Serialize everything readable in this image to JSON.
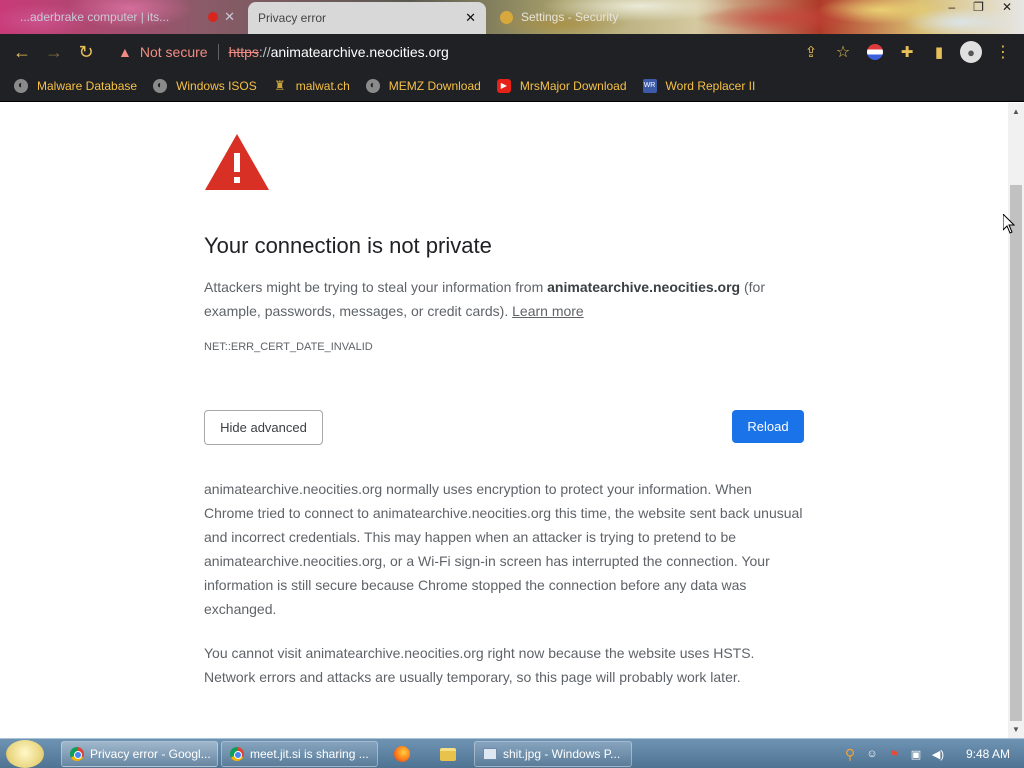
{
  "browser": {
    "tabs": [
      {
        "title": "...aderbrake computer | its...",
        "active": false
      },
      {
        "title": "Privacy error",
        "active": true
      },
      {
        "title": "Settings - Security",
        "active": false
      }
    ],
    "window_controls": {
      "minimize": "–",
      "maximize": "❐",
      "close": "✕"
    },
    "omnibox": {
      "security_label": "Not secure",
      "url_scheme": "https",
      "url_separator": "://",
      "url_host": "animatearchive.neocities.org"
    },
    "bookmarks": [
      {
        "label": "Malware Database",
        "icon": "globe-icon"
      },
      {
        "label": "Windows ISOS",
        "icon": "globe-icon"
      },
      {
        "label": "malwat.ch",
        "icon": "amogus-icon"
      },
      {
        "label": "MEMZ Download",
        "icon": "globe-icon"
      },
      {
        "label": "MrsMajor Download",
        "icon": "youtube-icon"
      },
      {
        "label": "Word Replacer II",
        "icon": "word-replacer-icon"
      }
    ]
  },
  "page": {
    "heading": "Your connection is not private",
    "intro_text": "Attackers might be trying to steal your information from ",
    "intro_domain": "animatearchive.neocities.org",
    "intro_text2": " (for example, passwords, messages, or credit cards). ",
    "learn_more": "Learn more",
    "error_code": "NET::ERR_CERT_DATE_INVALID",
    "hide_advanced_label": "Hide advanced",
    "reload_label": "Reload",
    "details_p1": "animatearchive.neocities.org normally uses encryption to protect your information. When Chrome tried to connect to animatearchive.neocities.org this time, the website sent back unusual and incorrect credentials. This may happen when an attacker is trying to pretend to be animatearchive.neocities.org, or a Wi-Fi sign-in screen has interrupted the connection. Your information is still secure because Chrome stopped the connection before any data was exchanged.",
    "details_p2": "You cannot visit animatearchive.neocities.org right now because the website uses HSTS. Network errors and attacks are usually temporary, so this page will probably work later."
  },
  "taskbar": {
    "items": [
      {
        "label": "Privacy error - Googl...",
        "icon": "chrome-icon"
      },
      {
        "label": "meet.jit.si is sharing ...",
        "icon": "chrome-icon"
      },
      {
        "label": "shit.jpg - Windows P...",
        "icon": "photo-viewer-icon"
      }
    ],
    "clock": "9:48 AM"
  },
  "colors": {
    "warning_red": "#d93025",
    "reload_blue": "#1a73e8",
    "bookmark_text": "#f5c046",
    "toolbar_bg": "#202124"
  }
}
